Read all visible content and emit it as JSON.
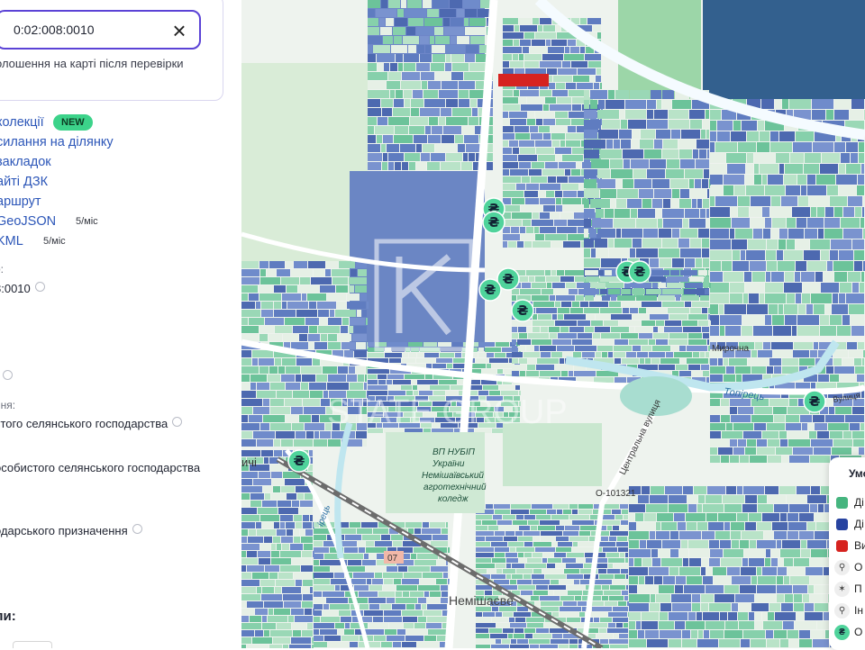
{
  "search": {
    "value": "0:02:008:0010",
    "hint": "олошення на карті після перевірки"
  },
  "actions": {
    "collections": "колекції",
    "new_badge": "NEW",
    "share_link": "силання на ділянку",
    "bookmarks": "закладок",
    "dzk_site": "айті ДЗК",
    "route": "аршрут",
    "geojson": "GeoJSON",
    "geojson_quota": "5/міс",
    "kml": "KML",
    "kml_quota": "5/міс"
  },
  "info": {
    "label_cadastre": "о:",
    "cadastre": "8:0010",
    "value_partial": "²",
    "label_purpose": "ння:",
    "purpose": "стого селянського господарства",
    "category": "особистого селянського господарства",
    "land_use": "одарського призначення",
    "section_title": "ли:"
  },
  "map": {
    "labels": {
      "farm_college_1": "ВП НУБІП",
      "farm_college_2": "України",
      "farm_college_3": "Немішаївський",
      "farm_college_4": "агротехнічний",
      "farm_college_5": "коледж",
      "town": "Немішаєве",
      "river": "Топірець",
      "river_left": "ірець",
      "street": "Центральна вулиця",
      "street_mir": "Мирочна",
      "street_right": "Вулиця",
      "road_code": "О-101321",
      "road_sign": "07",
      "left_edge": "ичі",
      "watermark": "STATE GROUP"
    },
    "marker_icon": "hryvnia-sale-icon",
    "marker_glyph": "₴",
    "colors": {
      "parcel_green": "#7fcfa5",
      "parcel_blue": "#5775b8",
      "highlight_red": "#d6231f",
      "marker": "#4fd39b"
    }
  },
  "legend": {
    "title": "Умо",
    "items": [
      {
        "label": "Ді",
        "color": "#46b57f",
        "kind": "swatch"
      },
      {
        "label": "Ді",
        "color": "#2743a0",
        "kind": "swatch"
      },
      {
        "label": "Ви",
        "color": "#d6231f",
        "kind": "swatch"
      },
      {
        "label": "О",
        "icon": "walk-icon",
        "kind": "icon"
      },
      {
        "label": "П",
        "icon": "flame-icon",
        "kind": "icon"
      },
      {
        "label": "Ін",
        "icon": "walk-icon",
        "kind": "icon"
      },
      {
        "label": "О",
        "icon": "hryvnia-sale-icon",
        "kind": "icon"
      }
    ]
  }
}
